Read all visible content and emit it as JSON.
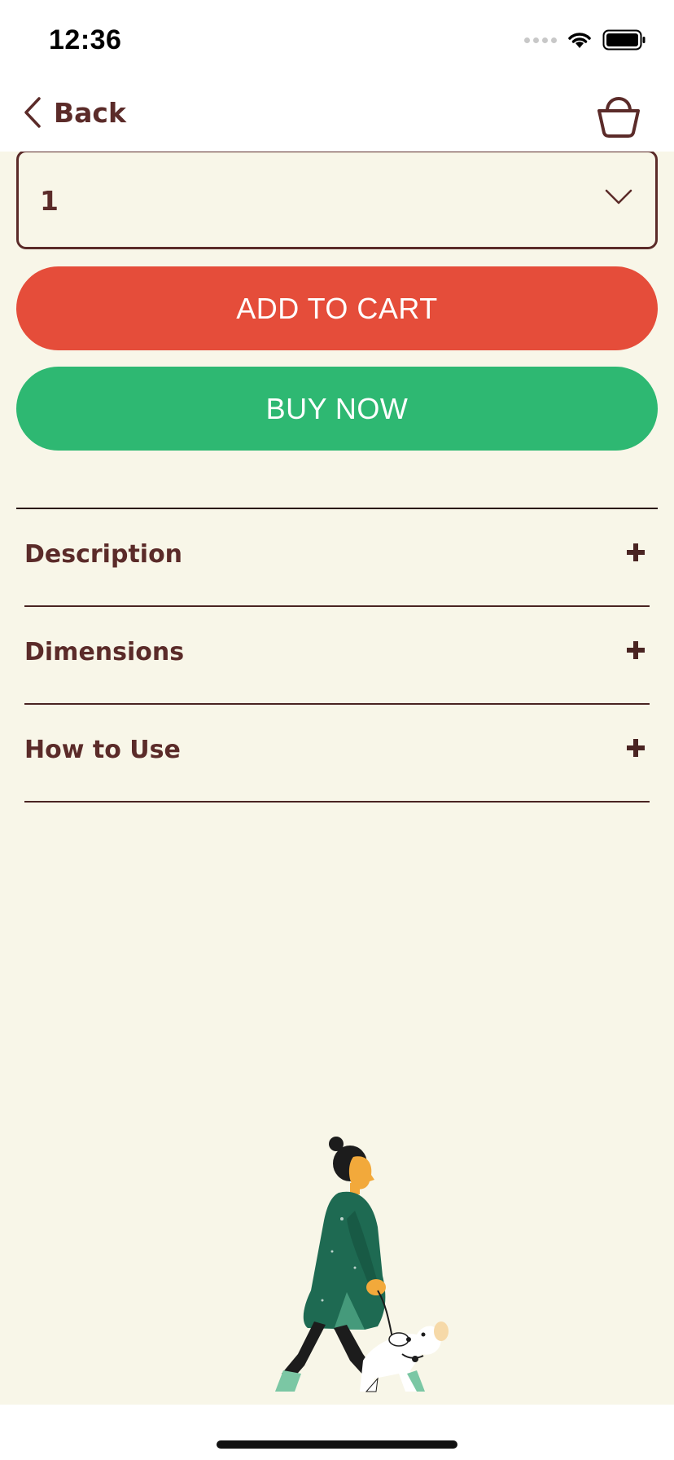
{
  "status_bar": {
    "time": "12:36"
  },
  "nav": {
    "back_label": "Back",
    "back_icon": "chevron-left-icon",
    "cart_icon": "shopping-basket-icon"
  },
  "quantity": {
    "selected": "1"
  },
  "actions": {
    "add_to_cart": "ADD TO CART",
    "buy_now": "BUY NOW"
  },
  "accordion": [
    {
      "label": "Description"
    },
    {
      "label": "Dimensions"
    },
    {
      "label": "How to Use"
    }
  ],
  "colors": {
    "brand_text": "#5b2b29",
    "background": "#f8f6e8",
    "add_to_cart": "#e54d3a",
    "buy_now": "#2eb872"
  }
}
